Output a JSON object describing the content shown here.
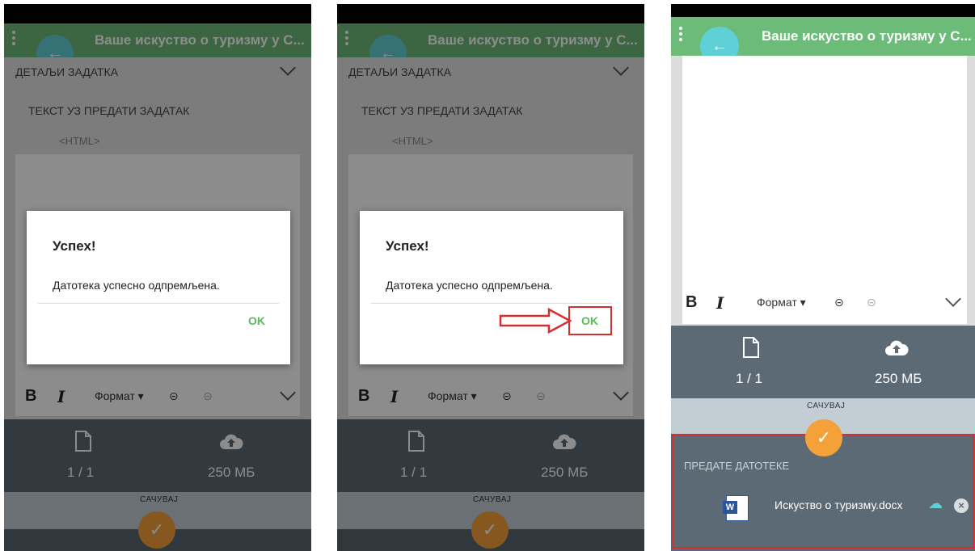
{
  "app": {
    "title": "Ваше искуство о туризму у С...",
    "back_icon": "←"
  },
  "details": {
    "label": "ДЕТАЉИ ЗАДАТКА",
    "text_label": "ТЕКСТ УЗ ПРЕДАТИ ЗАДАТАК",
    "format_hint": "<HTML>"
  },
  "toolbar": {
    "bold": "B",
    "italic": "I",
    "format": "Формат ▾",
    "link_icon": "⊝",
    "unlink_icon": "⊝"
  },
  "stats": {
    "files_count": "1 / 1",
    "storage": "250 МБ"
  },
  "save": {
    "label": "САЧУВАЈ",
    "check": "✓"
  },
  "dialog": {
    "title": "Успех!",
    "message": "Датотека успесно одпремљена.",
    "ok": "OK"
  },
  "files": {
    "label": "ПРЕДАТЕ ДАТОТЕКЕ",
    "items": [
      {
        "name": "Искуство о туризму.docx"
      }
    ],
    "word_icon_letter": "W",
    "remove_icon": "×",
    "cloud_icon": "☁"
  },
  "colors": {
    "appbar": "#6dbb78",
    "accent_fab": "#f5a139",
    "back_button": "#5fd0d6",
    "highlight": "#d32f2f",
    "ok": "#5cb85c"
  }
}
